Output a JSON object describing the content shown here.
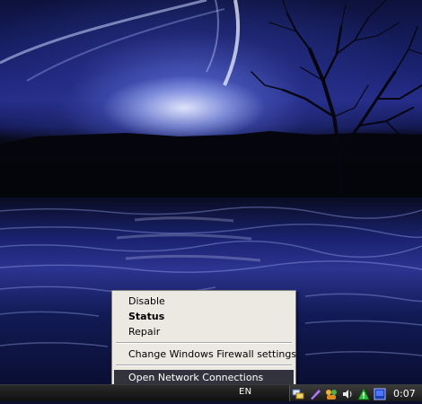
{
  "context_menu": {
    "items": [
      {
        "label": "Disable",
        "bold": false,
        "highlighted": false
      },
      {
        "label": "Status",
        "bold": true,
        "highlighted": false
      },
      {
        "label": "Repair",
        "bold": false,
        "highlighted": false
      },
      {
        "label": "Change Windows Firewall settings",
        "bold": false,
        "highlighted": false
      },
      {
        "label": "Open Network Connections",
        "bold": false,
        "highlighted": true
      }
    ]
  },
  "taskbar": {
    "language": "EN",
    "clock": "0:07",
    "tray_icons": [
      "network-connection-icon",
      "pen-icon",
      "users-icon",
      "volume-icon",
      "alert-triangle-icon",
      "monitor-icon"
    ]
  },
  "colors": {
    "menu_background": "#ece9e3",
    "menu_highlight": "#33333d",
    "taskbar": "#1a1a1a"
  }
}
